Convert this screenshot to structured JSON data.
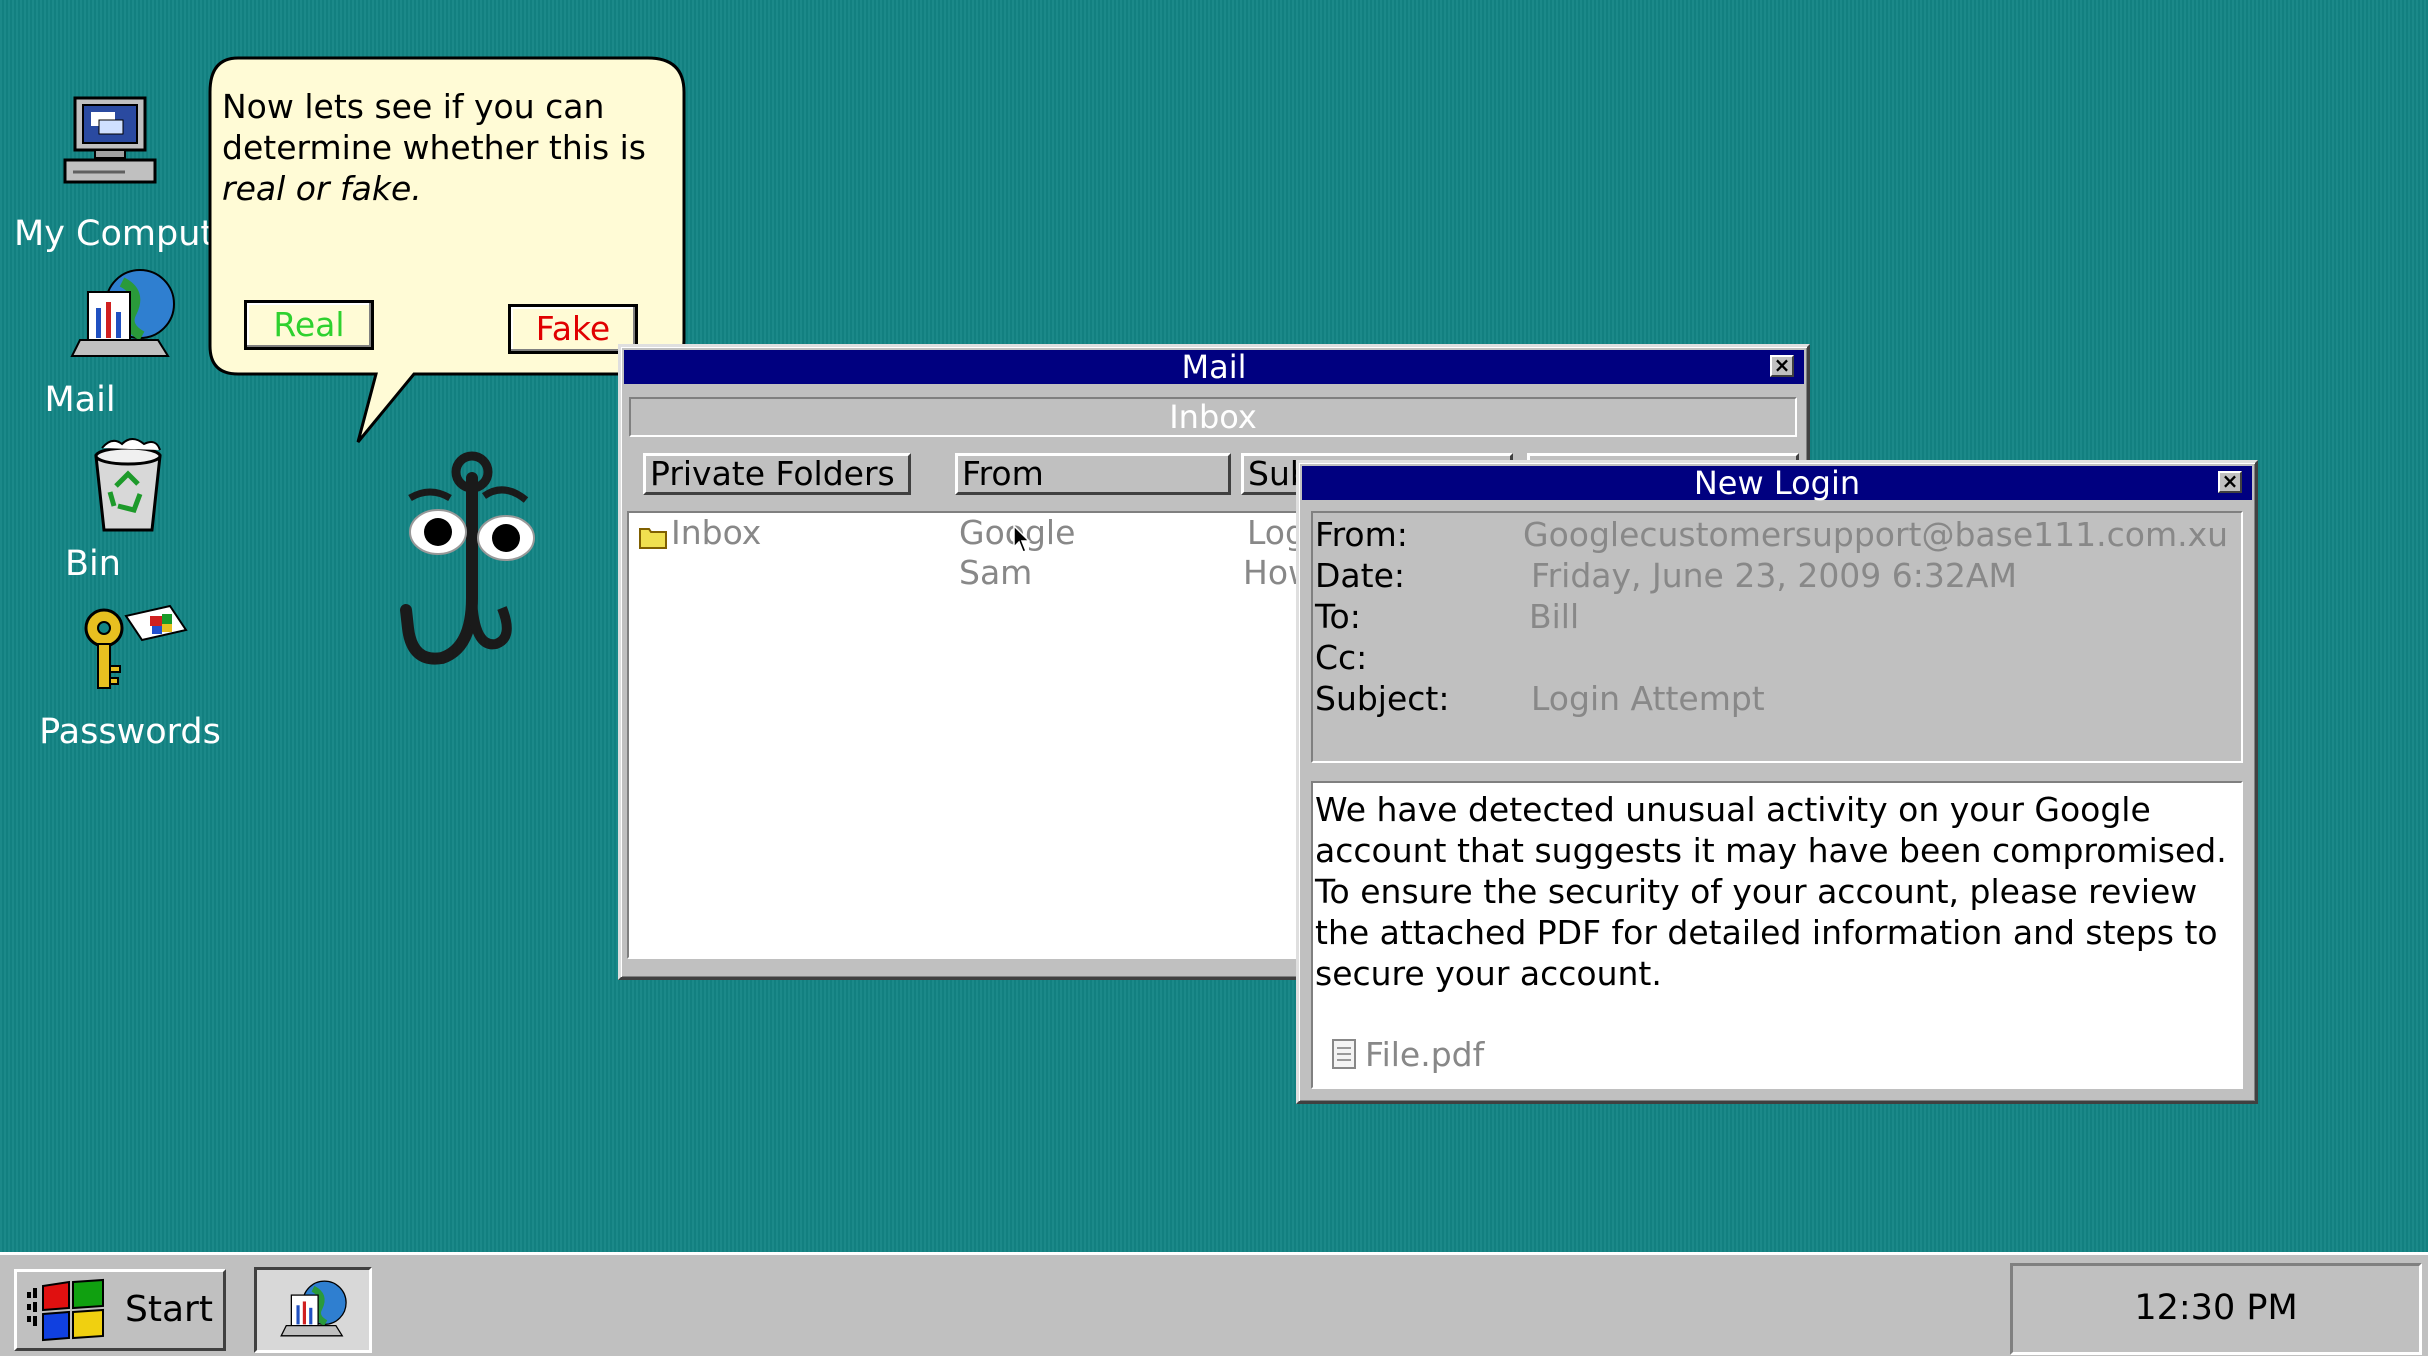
{
  "desktop": {
    "icons": [
      {
        "label": "My Comput"
      },
      {
        "label": "Mail"
      },
      {
        "label": "Bin"
      },
      {
        "label": "Passwords"
      }
    ]
  },
  "assistant": {
    "line1": "Now lets see if you can determine whether this is",
    "italic": "real or fake.",
    "real_label": "Real",
    "fake_label": "Fake"
  },
  "mail_window": {
    "title": "Mail",
    "folder_bar": "Inbox",
    "columns": [
      "Private Folders",
      "From",
      "Sub",
      ""
    ],
    "folders": [
      {
        "label": "Inbox"
      }
    ],
    "messages": [
      {
        "from": "Google",
        "subject": "Log"
      },
      {
        "from": "Sam",
        "subject": "How"
      }
    ]
  },
  "login_window": {
    "title": "New Login",
    "fields": {
      "from_label": "From:",
      "from_value": "Googlecustomersupport@base111.com.xu",
      "date_label": "Date:",
      "date_value": "Friday, June 23, 2009 6:32AM",
      "to_label": "To:",
      "to_value": "Bill",
      "cc_label": "Cc:",
      "cc_value": "",
      "subject_label": "Subject:",
      "subject_value": "Login Attempt"
    },
    "body": "We have detected unusual activity on your Google account that suggests it may have been compromised. To ensure the security of your account, please review the attached PDF for detailed information and steps to secure your account.",
    "attachment": "File.pdf"
  },
  "taskbar": {
    "start_label": "Start",
    "clock": "12:30 PM"
  }
}
